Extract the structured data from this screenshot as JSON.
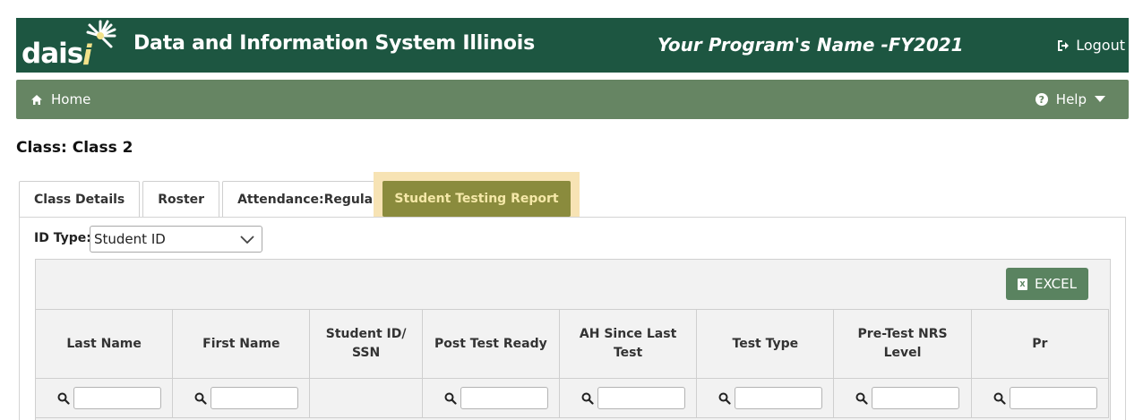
{
  "header": {
    "logo_text": "dais",
    "logo_accent": "i",
    "system_title": "Data and Information System Illinois",
    "program_name": "Your Program's Name -FY2021",
    "logout_label": "Logout"
  },
  "nav": {
    "home_label": "Home",
    "help_label": "Help"
  },
  "page": {
    "class_title": "Class: Class 2"
  },
  "tabs": [
    {
      "label": "Class Details"
    },
    {
      "label": "Roster"
    },
    {
      "label": "Attendance:Regular"
    },
    {
      "label": "Student Testing Report",
      "active": true
    }
  ],
  "controls": {
    "id_type_label": "ID Type:",
    "id_type_selected": "Student ID",
    "excel_label": "EXCEL"
  },
  "table": {
    "columns": [
      {
        "label": "Last Name",
        "filter": true
      },
      {
        "label": "First Name",
        "filter": true
      },
      {
        "label": "Student ID/ SSN",
        "filter": false
      },
      {
        "label": "Post Test Ready",
        "filter": true
      },
      {
        "label": "AH Since Last Test",
        "filter": true
      },
      {
        "label": "Test Type",
        "filter": true
      },
      {
        "label": "Pre-Test NRS Level",
        "filter": true
      },
      {
        "label": "Pr",
        "filter": true
      }
    ]
  },
  "colors": {
    "header_bg": "#1d5641",
    "nav_bg": "#668563",
    "active_tab_bg": "#8a8b3d",
    "active_tab_highlight": "#f7e3b4",
    "excel_bg": "#5a8360"
  }
}
